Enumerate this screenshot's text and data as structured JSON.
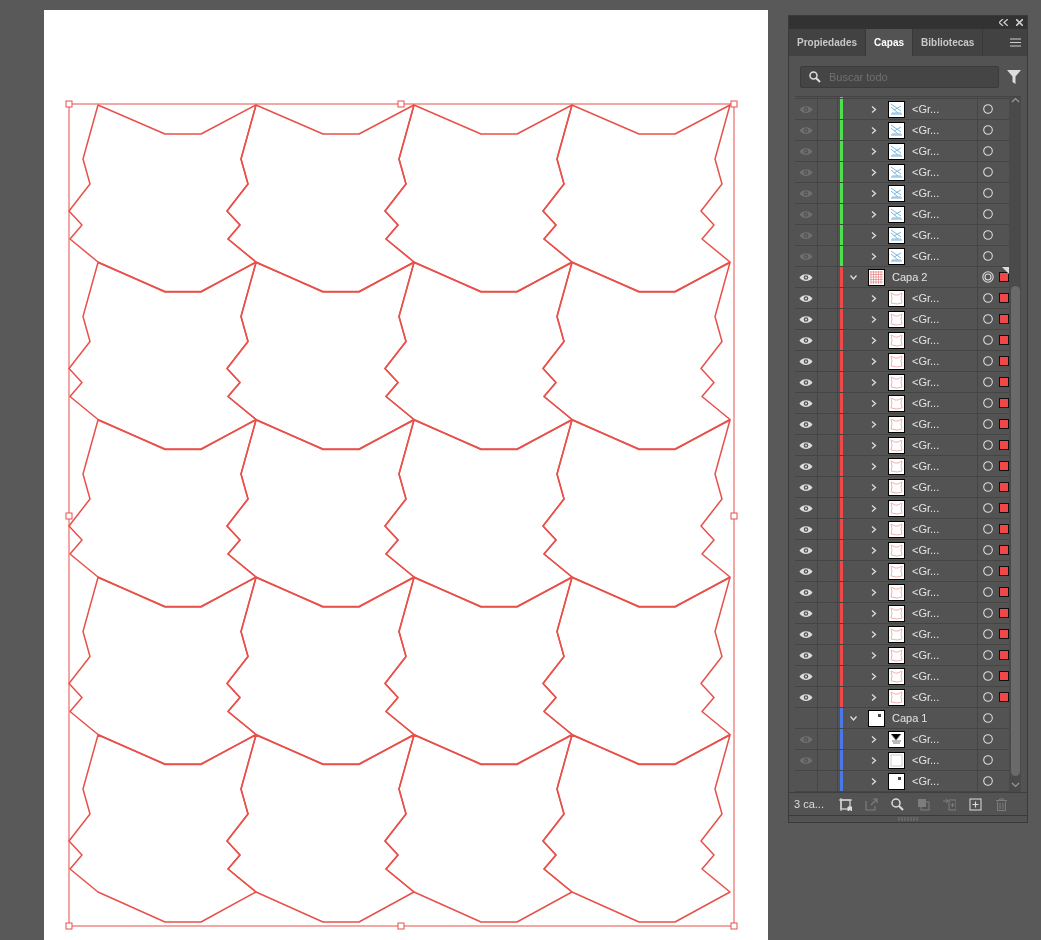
{
  "panel": {
    "tabs": [
      {
        "label": "Propiedades",
        "selected": false
      },
      {
        "label": "Capas",
        "selected": true
      },
      {
        "label": "Bibliotecas",
        "selected": false
      }
    ],
    "search": {
      "placeholder": "Buscar todo"
    },
    "layers": [
      {
        "kind": "offscreen",
        "children": [
          {
            "kind": "group",
            "name": "<Gr...",
            "color": "#4ee04e",
            "thumbnail": {
              "kind": "sketch"
            },
            "visible": true,
            "dimmed": true,
            "expanded": false,
            "targeted": false,
            "selected": false
          },
          {
            "kind": "group",
            "name": "<Gr...",
            "color": "#4ee04e",
            "thumbnail": {
              "kind": "sketch"
            },
            "visible": true,
            "dimmed": true,
            "expanded": false,
            "targeted": false,
            "selected": false
          },
          {
            "kind": "group",
            "name": "<Gr...",
            "color": "#4ee04e",
            "thumbnail": {
              "kind": "sketch"
            },
            "visible": true,
            "dimmed": true,
            "expanded": false,
            "targeted": false,
            "selected": false
          },
          {
            "kind": "group",
            "name": "<Gr...",
            "color": "#4ee04e",
            "thumbnail": {
              "kind": "sketch"
            },
            "visible": true,
            "dimmed": true,
            "expanded": false,
            "targeted": false,
            "selected": false
          },
          {
            "kind": "group",
            "name": "<Gr...",
            "color": "#4ee04e",
            "thumbnail": {
              "kind": "sketch"
            },
            "visible": true,
            "dimmed": true,
            "expanded": false,
            "targeted": false,
            "selected": false
          },
          {
            "kind": "group",
            "name": "<Gr...",
            "color": "#4ee04e",
            "thumbnail": {
              "kind": "sketch"
            },
            "visible": true,
            "dimmed": true,
            "expanded": false,
            "targeted": false,
            "selected": false
          },
          {
            "kind": "group",
            "name": "<Gr...",
            "color": "#4ee04e",
            "thumbnail": {
              "kind": "sketch"
            },
            "visible": true,
            "dimmed": true,
            "expanded": false,
            "targeted": false,
            "selected": false
          },
          {
            "kind": "group",
            "name": "<Gr...",
            "color": "#4ee04e",
            "thumbnail": {
              "kind": "sketch"
            },
            "visible": true,
            "dimmed": true,
            "expanded": false,
            "targeted": false,
            "selected": false
          }
        ]
      },
      {
        "kind": "layer",
        "name": "Capa 2",
        "color": "#f04848",
        "thumbnail": {
          "kind": "grid"
        },
        "visible": true,
        "dimmed": false,
        "expanded": true,
        "targeted": true,
        "selected": true,
        "current": true,
        "children": [
          {
            "kind": "group",
            "name": "<Gr...",
            "color": "#f04848",
            "thumbnail": {
              "kind": "outline"
            },
            "visible": true,
            "dimmed": false,
            "expanded": false,
            "targeted": false,
            "selected": true
          },
          {
            "kind": "group",
            "name": "<Gr...",
            "color": "#f04848",
            "thumbnail": {
              "kind": "outline"
            },
            "visible": true,
            "dimmed": false,
            "expanded": false,
            "targeted": false,
            "selected": true
          },
          {
            "kind": "group",
            "name": "<Gr...",
            "color": "#f04848",
            "thumbnail": {
              "kind": "outline"
            },
            "visible": true,
            "dimmed": false,
            "expanded": false,
            "targeted": false,
            "selected": true
          },
          {
            "kind": "group",
            "name": "<Gr...",
            "color": "#f04848",
            "thumbnail": {
              "kind": "outline"
            },
            "visible": true,
            "dimmed": false,
            "expanded": false,
            "targeted": false,
            "selected": true
          },
          {
            "kind": "group",
            "name": "<Gr...",
            "color": "#f04848",
            "thumbnail": {
              "kind": "outline"
            },
            "visible": true,
            "dimmed": false,
            "expanded": false,
            "targeted": false,
            "selected": true
          },
          {
            "kind": "group",
            "name": "<Gr...",
            "color": "#f04848",
            "thumbnail": {
              "kind": "outline"
            },
            "visible": true,
            "dimmed": false,
            "expanded": false,
            "targeted": false,
            "selected": true
          },
          {
            "kind": "group",
            "name": "<Gr...",
            "color": "#f04848",
            "thumbnail": {
              "kind": "outline"
            },
            "visible": true,
            "dimmed": false,
            "expanded": false,
            "targeted": false,
            "selected": true
          },
          {
            "kind": "group",
            "name": "<Gr...",
            "color": "#f04848",
            "thumbnail": {
              "kind": "outline"
            },
            "visible": true,
            "dimmed": false,
            "expanded": false,
            "targeted": false,
            "selected": true
          },
          {
            "kind": "group",
            "name": "<Gr...",
            "color": "#f04848",
            "thumbnail": {
              "kind": "outline"
            },
            "visible": true,
            "dimmed": false,
            "expanded": false,
            "targeted": false,
            "selected": true
          },
          {
            "kind": "group",
            "name": "<Gr...",
            "color": "#f04848",
            "thumbnail": {
              "kind": "outline"
            },
            "visible": true,
            "dimmed": false,
            "expanded": false,
            "targeted": false,
            "selected": true
          },
          {
            "kind": "group",
            "name": "<Gr...",
            "color": "#f04848",
            "thumbnail": {
              "kind": "outline"
            },
            "visible": true,
            "dimmed": false,
            "expanded": false,
            "targeted": false,
            "selected": true
          },
          {
            "kind": "group",
            "name": "<Gr...",
            "color": "#f04848",
            "thumbnail": {
              "kind": "outline"
            },
            "visible": true,
            "dimmed": false,
            "expanded": false,
            "targeted": false,
            "selected": true
          },
          {
            "kind": "group",
            "name": "<Gr...",
            "color": "#f04848",
            "thumbnail": {
              "kind": "outline"
            },
            "visible": true,
            "dimmed": false,
            "expanded": false,
            "targeted": false,
            "selected": true
          },
          {
            "kind": "group",
            "name": "<Gr...",
            "color": "#f04848",
            "thumbnail": {
              "kind": "outline"
            },
            "visible": true,
            "dimmed": false,
            "expanded": false,
            "targeted": false,
            "selected": true
          },
          {
            "kind": "group",
            "name": "<Gr...",
            "color": "#f04848",
            "thumbnail": {
              "kind": "outline"
            },
            "visible": true,
            "dimmed": false,
            "expanded": false,
            "targeted": false,
            "selected": true
          },
          {
            "kind": "group",
            "name": "<Gr...",
            "color": "#f04848",
            "thumbnail": {
              "kind": "outline"
            },
            "visible": true,
            "dimmed": false,
            "expanded": false,
            "targeted": false,
            "selected": true
          },
          {
            "kind": "group",
            "name": "<Gr...",
            "color": "#f04848",
            "thumbnail": {
              "kind": "outline"
            },
            "visible": true,
            "dimmed": false,
            "expanded": false,
            "targeted": false,
            "selected": true
          },
          {
            "kind": "group",
            "name": "<Gr...",
            "color": "#f04848",
            "thumbnail": {
              "kind": "outline"
            },
            "visible": true,
            "dimmed": false,
            "expanded": false,
            "targeted": false,
            "selected": true
          },
          {
            "kind": "group",
            "name": "<Gr...",
            "color": "#f04848",
            "thumbnail": {
              "kind": "outline"
            },
            "visible": true,
            "dimmed": false,
            "expanded": false,
            "targeted": false,
            "selected": true
          },
          {
            "kind": "group",
            "name": "<Gr...",
            "color": "#f04848",
            "thumbnail": {
              "kind": "outline"
            },
            "visible": true,
            "dimmed": false,
            "expanded": false,
            "targeted": false,
            "selected": true
          }
        ]
      },
      {
        "kind": "layer",
        "name": "Capa 1",
        "color": "#4a78e8",
        "thumbnail": {
          "kind": "dot"
        },
        "visible": false,
        "expanded": true,
        "targeted": false,
        "selected": false,
        "current": false,
        "children": [
          {
            "kind": "group",
            "name": "<Gr...",
            "color": "#4a78e8",
            "thumbnail": {
              "kind": "sketch-mono"
            },
            "visible": true,
            "dimmed": true,
            "expanded": false,
            "targeted": false,
            "selected": false
          },
          {
            "kind": "group",
            "name": "<Gr...",
            "color": "#4a78e8",
            "thumbnail": {
              "kind": "frame"
            },
            "visible": true,
            "dimmed": true,
            "expanded": false,
            "targeted": false,
            "selected": false
          },
          {
            "kind": "group",
            "name": "<Gr...",
            "color": "#4a78e8",
            "thumbnail": {
              "kind": "dot"
            },
            "visible": false,
            "expanded": false,
            "targeted": false,
            "selected": false
          }
        ]
      }
    ],
    "footer": {
      "count": "3 ca...",
      "buttons": [
        {
          "kind": "collect",
          "disabled": false
        },
        {
          "kind": "export",
          "disabled": true
        },
        {
          "kind": "locate",
          "disabled": false
        },
        {
          "kind": "mask",
          "disabled": true
        },
        {
          "kind": "sublayer",
          "disabled": true
        },
        {
          "kind": "new",
          "disabled": false
        },
        {
          "kind": "delete",
          "disabled": true
        }
      ]
    }
  }
}
